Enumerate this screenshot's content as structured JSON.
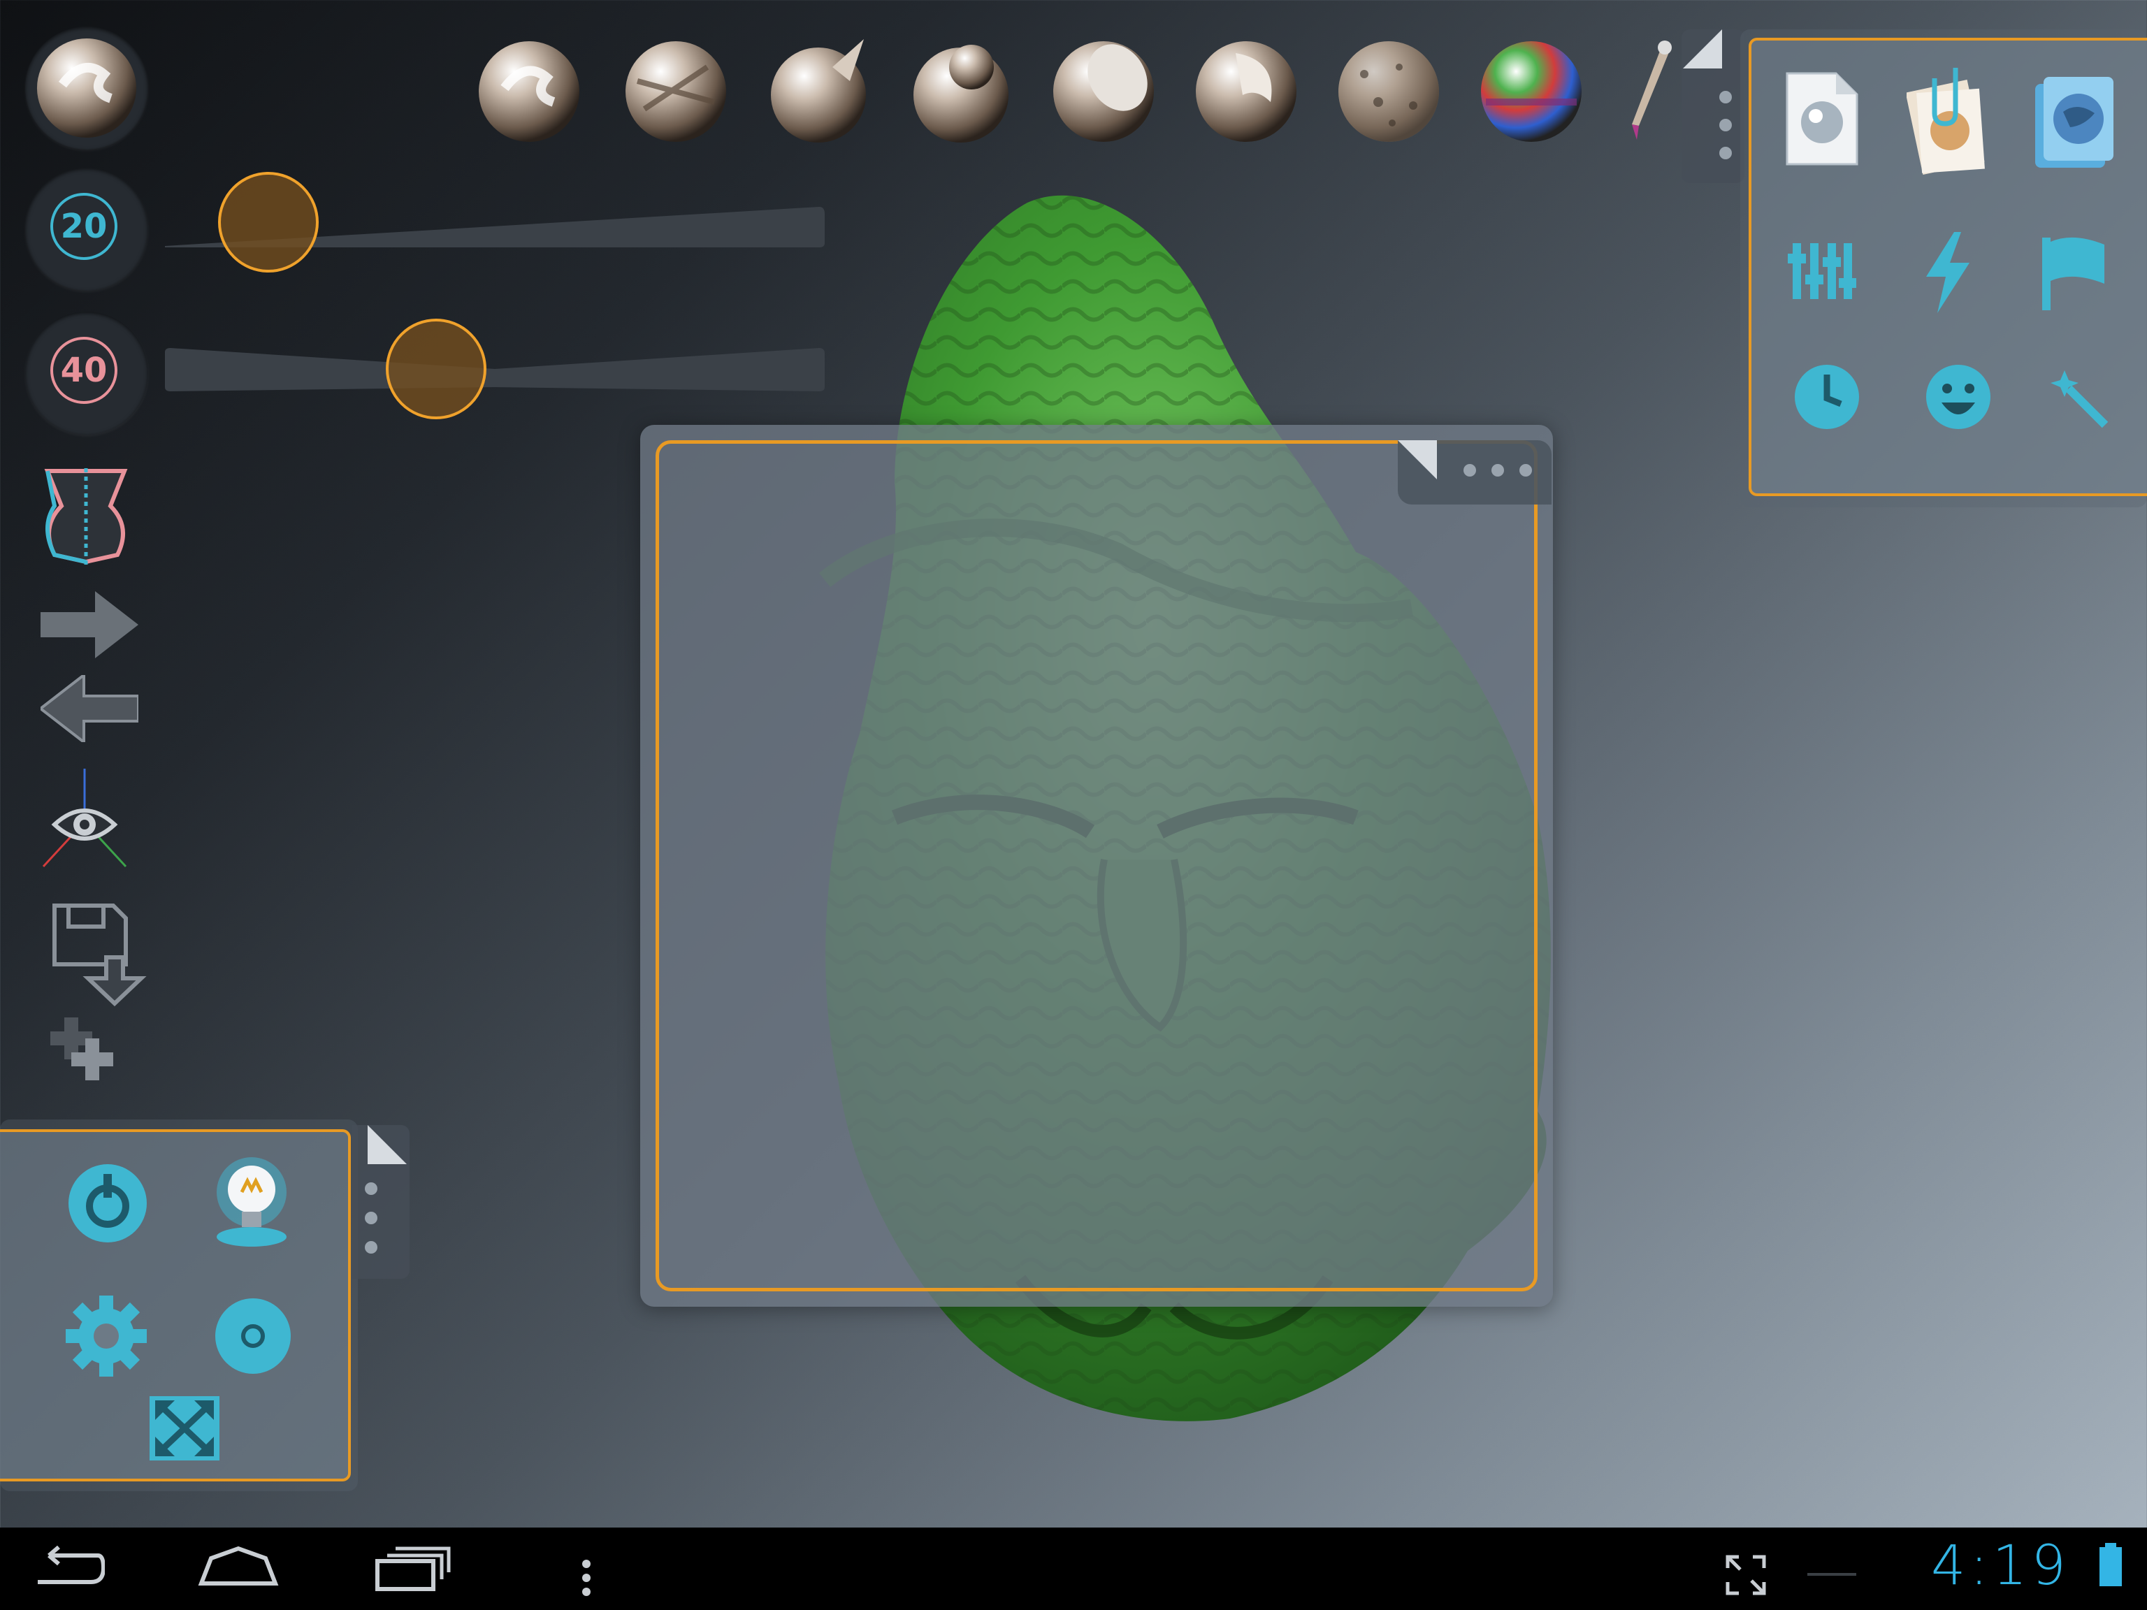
{
  "brush_sliders": {
    "radius_value": "20",
    "intensity_value": "40",
    "radius_level": 0.02,
    "intensity_level": 0.32
  },
  "brushes": [
    "draw-brush",
    "crease-brush",
    "pinch-brush",
    "inflate-brush",
    "flatten-brush",
    "smooth-brush",
    "noise-brush",
    "paint-brush",
    "pen-tool"
  ],
  "left_tools": [
    "symmetry",
    "redo",
    "undo",
    "camera-view",
    "save-export",
    "add-object"
  ],
  "file_panel": [
    "new-scene",
    "open-file",
    "export-file",
    "settings-sliders",
    "flash",
    "flag",
    "history-clock",
    "smiley",
    "magic-wand"
  ],
  "bottom_panel": [
    "power",
    "light-bulb",
    "gear",
    "record",
    "fullscreen"
  ],
  "status_bar": {
    "time": "4:19"
  },
  "colors": {
    "accent": "#e89a24",
    "icon_cyan": "#3fb7d1",
    "radius_ring": "#3fb7d1",
    "intensity_ring": "#e8929a",
    "clock": "#33b5e5"
  }
}
